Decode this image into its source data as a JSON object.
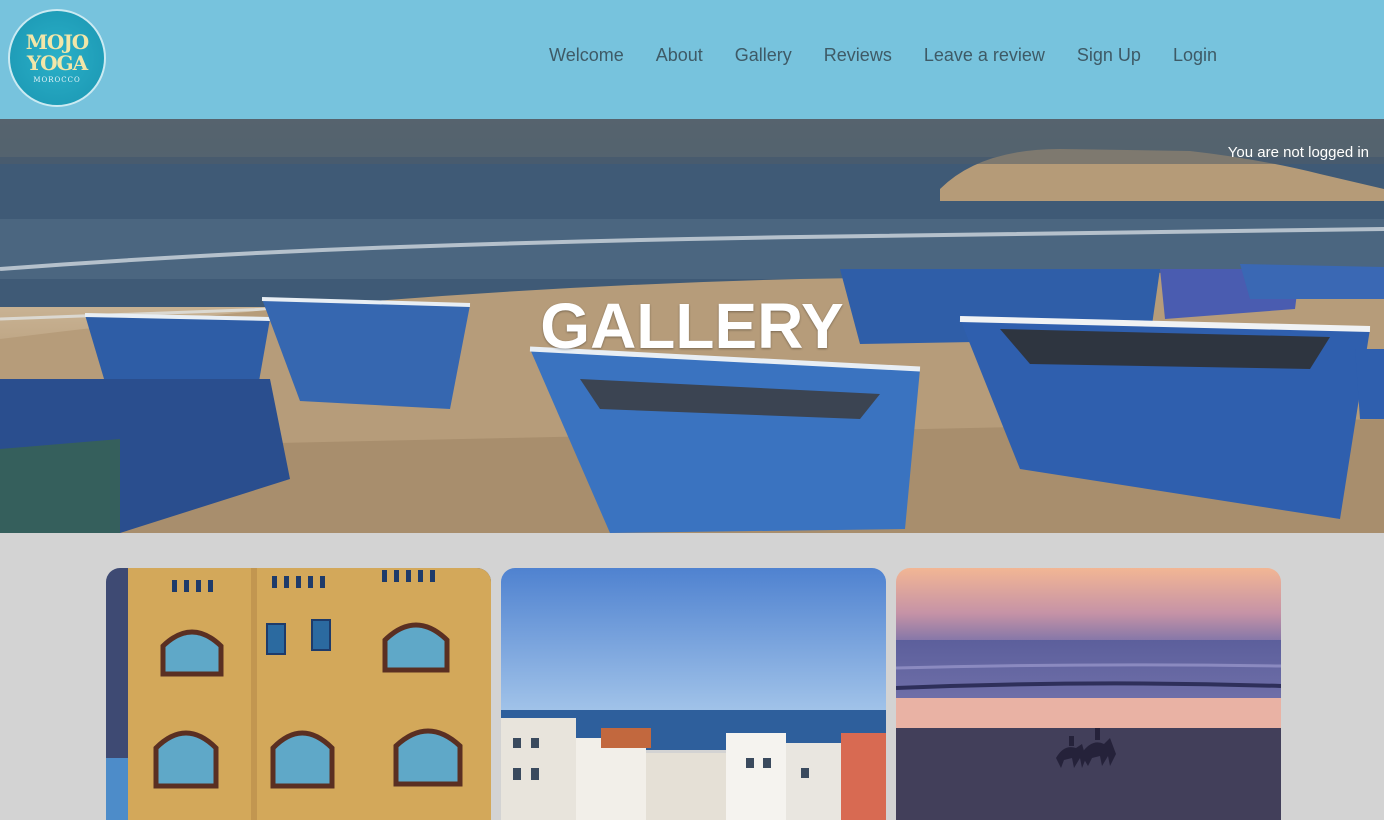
{
  "header": {
    "logo": {
      "line1": "MOJO",
      "line2": "YOGA",
      "line3": "MOROCCO"
    },
    "nav": [
      {
        "label": "Welcome"
      },
      {
        "label": "About"
      },
      {
        "label": "Gallery"
      },
      {
        "label": "Reviews"
      },
      {
        "label": "Leave a review"
      },
      {
        "label": "Sign Up"
      },
      {
        "label": "Login"
      }
    ]
  },
  "hero": {
    "login_status": "You are not logged in",
    "title": "GALLERY"
  },
  "colors": {
    "navbar_bg": "#77c3dd",
    "nav_text": "#3e5a66",
    "page_bg": "#d3d3d3"
  }
}
